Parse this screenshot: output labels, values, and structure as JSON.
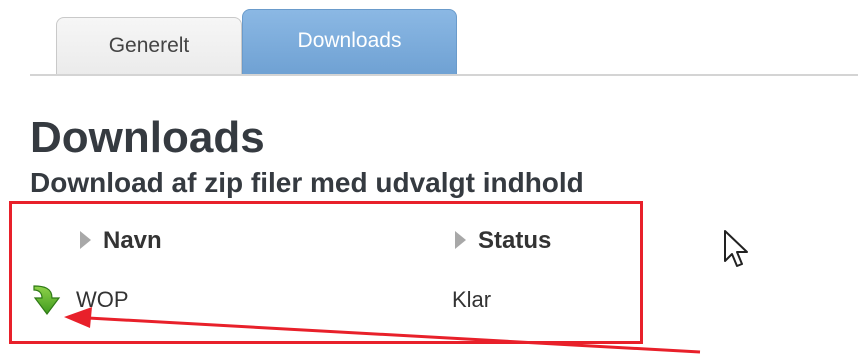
{
  "tabs": [
    {
      "label": "Generelt",
      "active": false
    },
    {
      "label": "Downloads",
      "active": true
    }
  ],
  "page": {
    "title": "Downloads",
    "subtitle": "Download af zip filer med udvalgt indhold"
  },
  "table": {
    "columns": [
      {
        "label": "Navn"
      },
      {
        "label": "Status"
      }
    ],
    "rows": [
      {
        "name": "WOP",
        "status": "Klar",
        "icon": "download-arrow-icon"
      }
    ]
  },
  "colors": {
    "active_tab": "#7aaadb",
    "annotation": "#e8202a",
    "download_icon": "#5aa832"
  }
}
